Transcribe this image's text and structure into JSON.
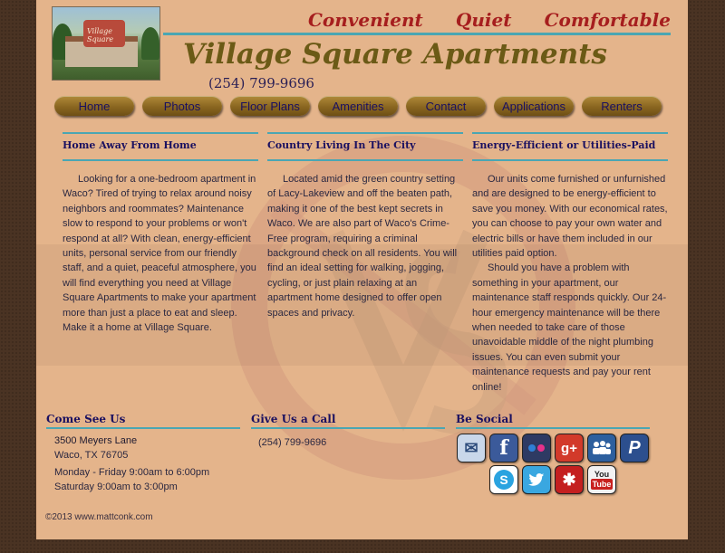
{
  "header": {
    "taglines": [
      "Convenient",
      "Quiet",
      "Comfortable"
    ],
    "title": "Village Square Apartments",
    "phone": "(254) 799-9696",
    "logo_sign": "Village Square"
  },
  "nav": {
    "items": [
      {
        "label": "Home"
      },
      {
        "label": "Photos"
      },
      {
        "label": "Floor Plans"
      },
      {
        "label": "Amenities"
      },
      {
        "label": "Contact"
      },
      {
        "label": "Applications"
      },
      {
        "label": "Renters"
      }
    ]
  },
  "columns": [
    {
      "heading": "Home Away From Home",
      "paragraphs": [
        "Looking for a one-bedroom apartment in Waco? Tired of trying to relax around noisy neighbors and roommates? Maintenance slow to respond to your problems or won't respond at all? With clean, energy-efficient units, personal service from our friendly staff, and a quiet, peaceful atmosphere, you will find everything you need at Village Square Apartments to make your apartment more than just a place to eat and sleep. Make it a home at Village Square."
      ]
    },
    {
      "heading": "Country Living In The City",
      "paragraphs": [
        "Located amid the green country setting of Lacy-Lakeview and off the beaten path, making it one of the best kept secrets in Waco. We are also part of Waco's Crime-Free program, requiring a criminal background check on all residents. You will find an ideal setting for walking, jogging, cycling, or just plain relaxing at an apartment home designed to offer open spaces and privacy."
      ]
    },
    {
      "heading": "Energy-Efficient or Utilities-Paid",
      "paragraphs": [
        "Our units come furnished or unfurnished and are designed to be energy-efficient to save you money. With our economical rates, you can choose to pay your own water and electric bills or have them included in our utilities paid option.",
        "Should you have a problem with something in your apartment, our maintenance staff responds quickly. Our 24-hour emergency maintenance will be there when needed to take care of those unavoidable middle of the night plumbing issues. You can even submit your maintenance requests and pay your rent online!"
      ]
    }
  ],
  "footer": {
    "come_see_us": {
      "heading": "Come See Us",
      "street": "3500 Meyers Lane",
      "city": "Waco, TX 76705",
      "hours_weekday": "Monday - Friday 9:00am to 6:00pm",
      "hours_saturday": "Saturday 9:00am to 3:00pm"
    },
    "call": {
      "heading": "Give Us a Call",
      "phone": "(254) 799-9696"
    },
    "social": {
      "heading": "Be Social",
      "icons": [
        {
          "name": "email-icon",
          "glyph": "✉",
          "color": "#9fb6d6"
        },
        {
          "name": "facebook-icon",
          "glyph": "f",
          "color": "#3b5a9a"
        },
        {
          "name": "flickr-icon",
          "glyph": "●●",
          "color": "#2e3a63"
        },
        {
          "name": "google-plus-icon",
          "glyph": "g+",
          "color": "#d23a2a"
        },
        {
          "name": "myspace-icon",
          "glyph": "👥",
          "color": "#2d5f9e"
        },
        {
          "name": "paypal-icon",
          "glyph": "P",
          "color": "#2c4f8e"
        },
        {
          "name": "skype-icon",
          "glyph": "S",
          "color": "#2aa3e0"
        },
        {
          "name": "twitter-icon",
          "glyph": "🐦",
          "color": "#3aa7e0"
        },
        {
          "name": "yelp-icon",
          "glyph": "✱",
          "color": "#c41f1f"
        },
        {
          "name": "youtube-icon",
          "glyph": "You Tube",
          "color": "#c8201e"
        }
      ]
    },
    "copyright": "©2013 www.mattconk.com"
  },
  "colors": {
    "page_bg": "#e4b48b",
    "outer_bg": "#4a3323",
    "accent_rule": "#4aa6b3",
    "tagline": "#a61e1e",
    "title": "#6b5a16",
    "heading_text": "#1a1060"
  }
}
